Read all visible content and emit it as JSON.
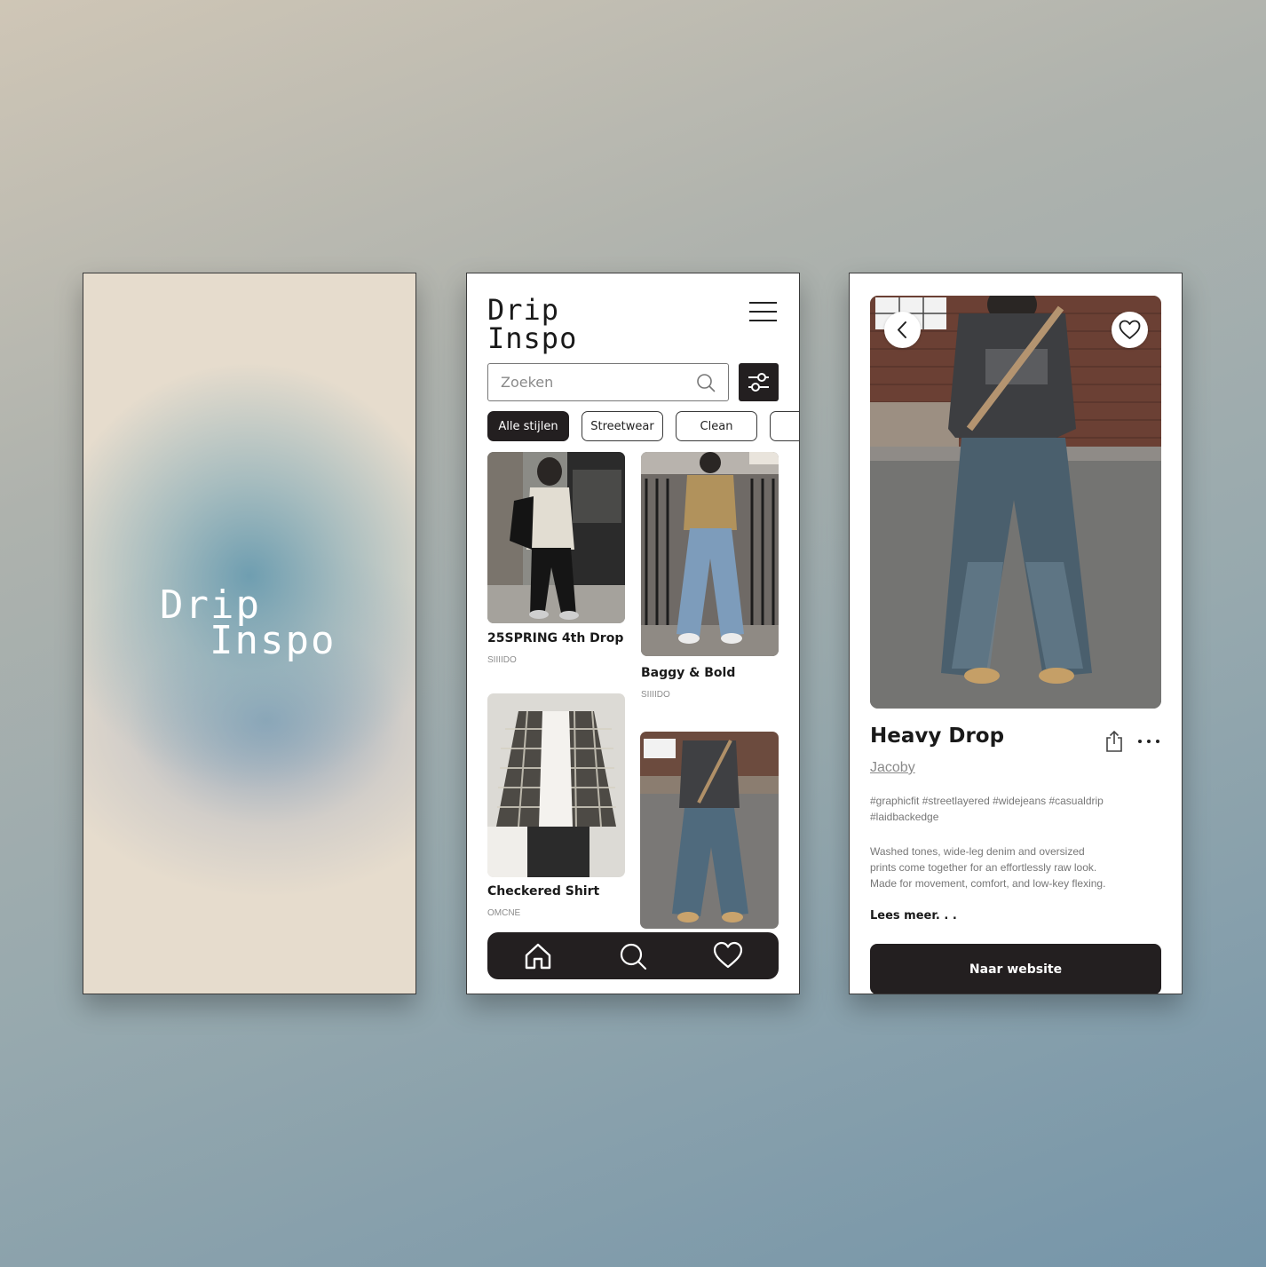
{
  "brand": {
    "logo_line1": "Drip",
    "logo_line2": "Inspo"
  },
  "home": {
    "search": {
      "placeholder": "Zoeken"
    },
    "filters": [
      "Alle stijlen",
      "Streetwear",
      "Clean",
      ""
    ],
    "cards": [
      {
        "title": "25SPRING 4th Drop",
        "brand": "SIIIIDO"
      },
      {
        "title": "Baggy & Bold",
        "brand": "SIIIIDO"
      },
      {
        "title": "Checkered Shirt",
        "brand": "OMCNE"
      },
      {
        "title": "",
        "brand": ""
      }
    ],
    "nav": [
      "home-icon",
      "search-icon",
      "heart-icon"
    ]
  },
  "detail": {
    "title": "Heavy Drop",
    "author": "Jacoby",
    "tags": "#graphicfit #streetlayered #widejeans #casualdrip #laidbackedge",
    "description": "Washed tones, wide-leg denim and oversized prints come together for an effortlessly raw look. Made for movement, comfort, and low-key flexing.",
    "read_more": "Lees meer. . .",
    "cta": "Naar website"
  },
  "colors": {
    "dark": "#231f20",
    "background": "#ffffff",
    "muted_text": "#8a8a8a"
  }
}
